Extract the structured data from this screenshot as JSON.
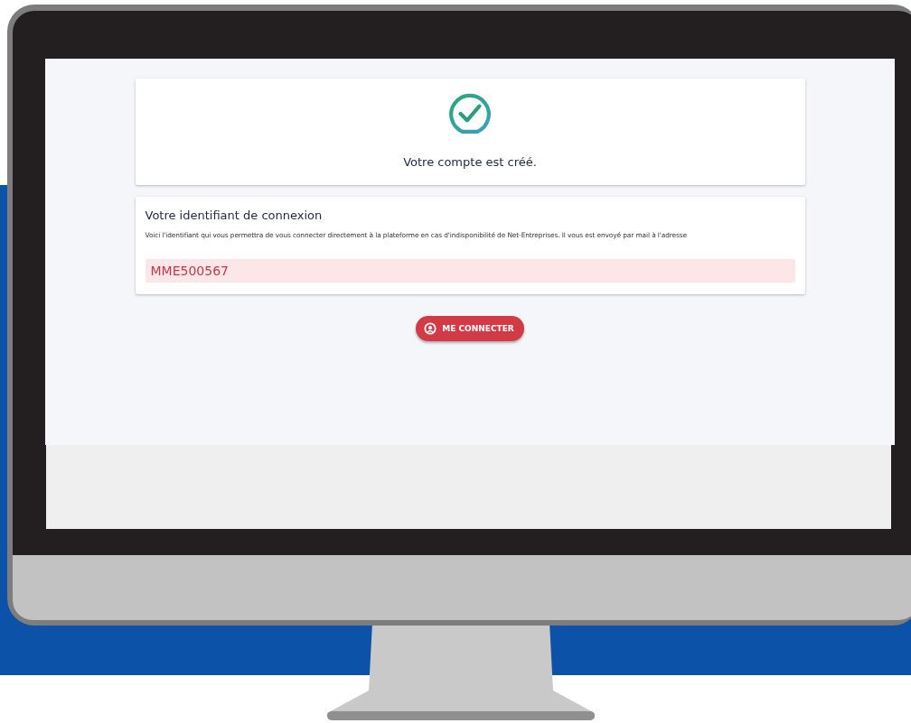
{
  "success_card": {
    "message": "Votre compte est créé."
  },
  "login_card": {
    "title": "Votre identifiant de connexion",
    "description": "Voici l'identifiant qui vous permettra de vous connecter directement à la plateforme en cas d'indisponibilité de Net-Entreprises. Il vous est envoyé par mail à l'adresse",
    "identifier": "MME500567"
  },
  "connect_button": {
    "label": "ME CONNECTER"
  }
}
